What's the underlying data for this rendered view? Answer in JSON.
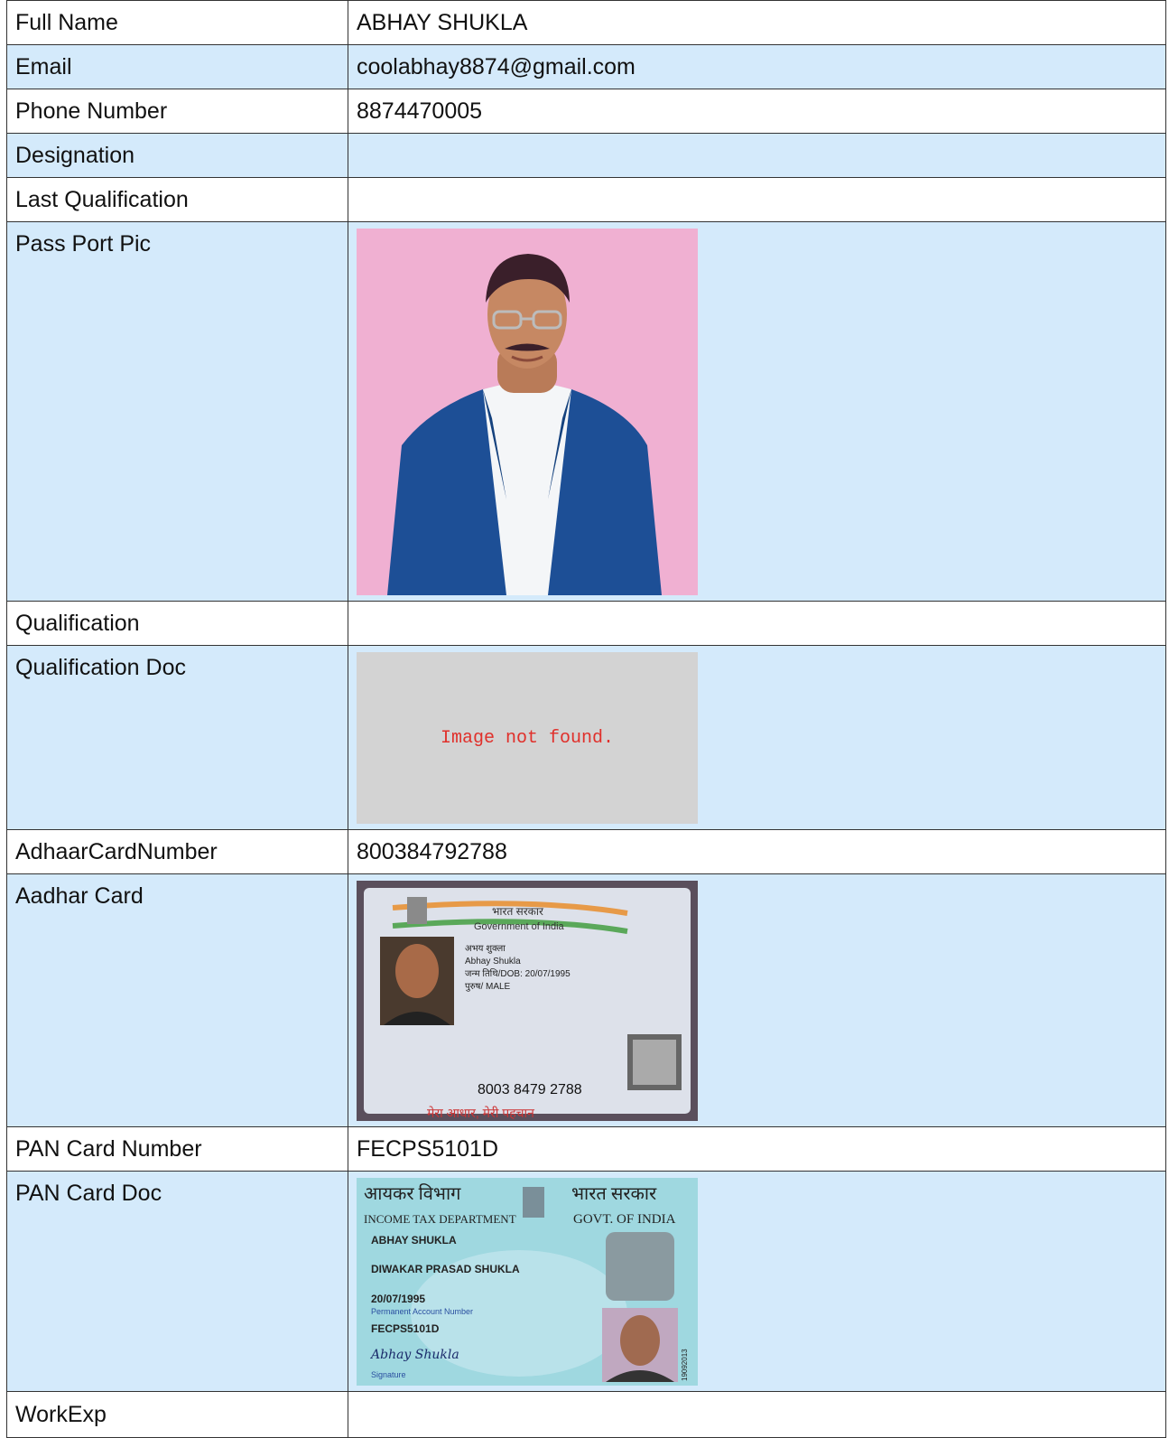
{
  "rows": [
    {
      "label": "Full Name",
      "value": "ABHAY SHUKLA"
    },
    {
      "label": "Email",
      "value": "coolabhay8874@gmail.com"
    },
    {
      "label": "Phone Number",
      "value": "8874470005"
    },
    {
      "label": "Designation",
      "value": ""
    },
    {
      "label": "Last Qualification",
      "value": ""
    },
    {
      "label": "Pass Port Pic"
    },
    {
      "label": "Qualification",
      "value": ""
    },
    {
      "label": "Qualification Doc",
      "image_error": "Image not found."
    },
    {
      "label": "AdhaarCardNumber",
      "value": "800384792788"
    },
    {
      "label": "Aadhar Card"
    },
    {
      "label": "PAN Card Number",
      "value": "FECPS5101D"
    },
    {
      "label": "PAN Card Doc"
    },
    {
      "label": "WorkExp",
      "value": ""
    }
  ],
  "aadhar": {
    "hindi_gov": "भारत सरकार",
    "gov": "Government of India",
    "name_hi": "अभय शुक्ला",
    "name": "Abhay Shukla",
    "dob": "जन्म तिथि/DOB: 20/07/1995",
    "gender": "पुरुष/ MALE",
    "number": "8003 8479 2788",
    "tagline": "मेरा आधार, मेरी पहचान"
  },
  "pan": {
    "dept_hi": "आयकर विभाग",
    "gov_hi": "भारत सरकार",
    "dept": "INCOME TAX DEPARTMENT",
    "gov": "GOVT. OF INDIA",
    "name": "ABHAY SHUKLA",
    "father": "DIWAKAR PRASAD SHUKLA",
    "dob": "20/07/1995",
    "pan_label": "Permanent Account Number",
    "pan": "FECPS5101D",
    "signature": "Abhay Shukla",
    "signature_label": "Signature",
    "serial": "19092013"
  }
}
